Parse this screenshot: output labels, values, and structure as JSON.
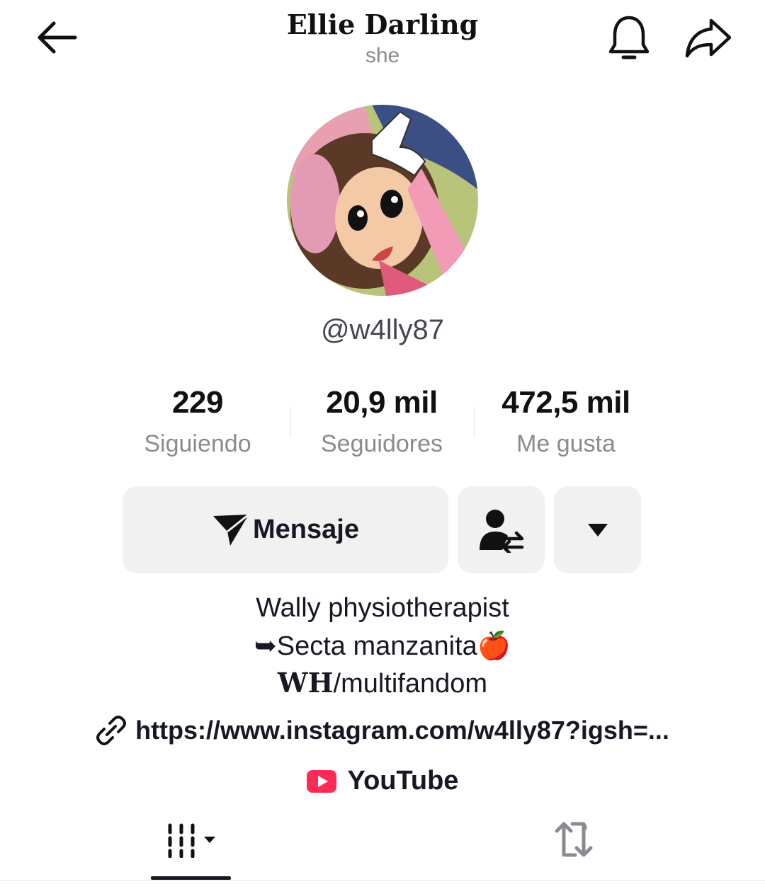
{
  "header": {
    "title": "Ellie Darling",
    "pronoun": "she",
    "back_icon": "arrow-left-icon",
    "notification_icon": "bell-icon",
    "share_icon": "share-arrow-icon"
  },
  "profile": {
    "username": "@w4lly87"
  },
  "stats": [
    {
      "value": "229",
      "label": "Siguiendo"
    },
    {
      "value": "20,9 mil",
      "label": "Seguidores"
    },
    {
      "value": "472,5 mil",
      "label": "Me gusta"
    }
  ],
  "actions": {
    "message_label": "Mensaje",
    "message_icon": "send-icon",
    "friend_icon": "user-swap-icon",
    "more_icon": "caret-down-icon"
  },
  "bio": {
    "line1": "Wally physiotherapist",
    "line2_arrow": "➥",
    "line2_text": "Secta manzanita",
    "line2_emoji": "🍎",
    "line3_bold": "WH",
    "line3_rest": "/multifandom"
  },
  "links": {
    "instagram": "https://www.instagram.com/w4lly87?igsh=...",
    "youtube": "YouTube"
  },
  "tabs": [
    {
      "icon": "grid-icon",
      "active": true
    },
    {
      "icon": "repost-icon",
      "active": false
    }
  ],
  "colors": {
    "text": "#161823",
    "muted": "#8a8b91",
    "button_bg": "#f1f1f2",
    "youtube_red": "#fe2c55"
  }
}
